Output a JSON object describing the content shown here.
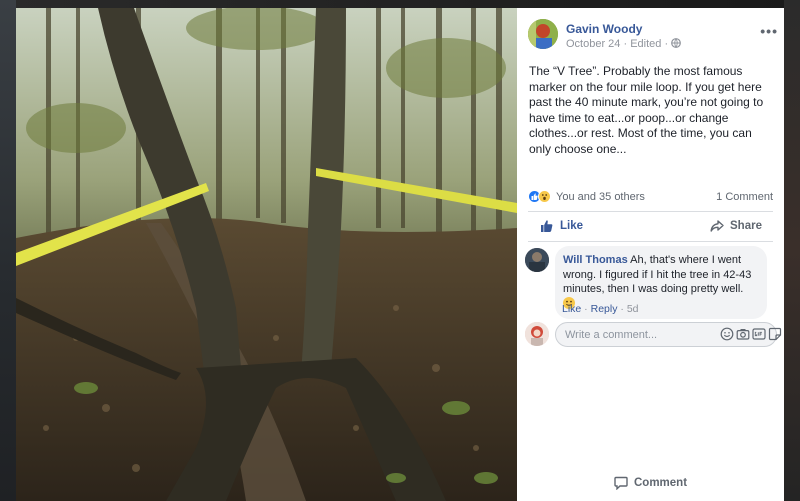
{
  "post": {
    "author": "Gavin Woody",
    "date": "October 24",
    "edited_label": "Edited",
    "meta_separator": "·",
    "more_label": "•••",
    "text": "The “V Tree”. Probably the most famous marker on the four mile loop. If you get here past the 40 minute mark, you’re not going to have time to eat...or poop...or change clothes...or rest. Most of the time, you can only choose one...",
    "reactions_text": "You and 35 others",
    "comment_count": "1 Comment"
  },
  "actions": {
    "like": "Like",
    "comment": "Comment",
    "share": "Share"
  },
  "comments": [
    {
      "author": "Will Thomas",
      "text": " Ah, that's where I went wrong. I figured if I hit the tree in 42-43 minutes, then I was doing pretty well. ",
      "like": "Like",
      "reply": "Reply",
      "age": "5d",
      "separator": " · "
    }
  ],
  "composer": {
    "placeholder": "Write a comment..."
  },
  "icons": [
    "globe-icon",
    "more-icon",
    "like-reaction-icon",
    "wow-reaction-icon",
    "like-icon",
    "comment-icon",
    "share-icon",
    "emoji-icon",
    "camera-icon",
    "gif-icon",
    "sticker-icon"
  ],
  "colors": {
    "link": "#385898",
    "like_reaction": "#2078f4",
    "text": "#1d2129",
    "muted": "#90949c"
  }
}
